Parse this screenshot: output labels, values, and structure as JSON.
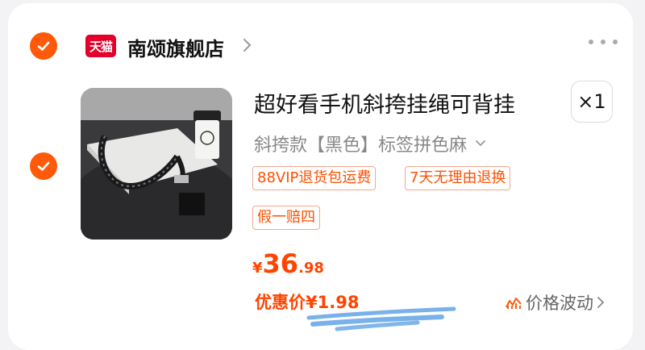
{
  "colors": {
    "accent": "#ff5a0a",
    "tmall_red": "#e4002b",
    "price": "#ff4400"
  },
  "shop": {
    "badge": "天猫",
    "name": "南颂旗舰店",
    "more_icon": "more-dots-icon"
  },
  "item": {
    "title": "超好看手机斜挎挂绳可背挂",
    "qty": "×1",
    "sku": "斜挎款【黑色】标签拼色麻",
    "tags": [
      "88VIP退货包运费",
      "7天无理由退换",
      "假一赔四"
    ],
    "price": {
      "currency": "¥",
      "integer": "36",
      "decimal": ".98"
    },
    "promo": "优惠价¥1.98",
    "fluctuation": "价格波动"
  }
}
